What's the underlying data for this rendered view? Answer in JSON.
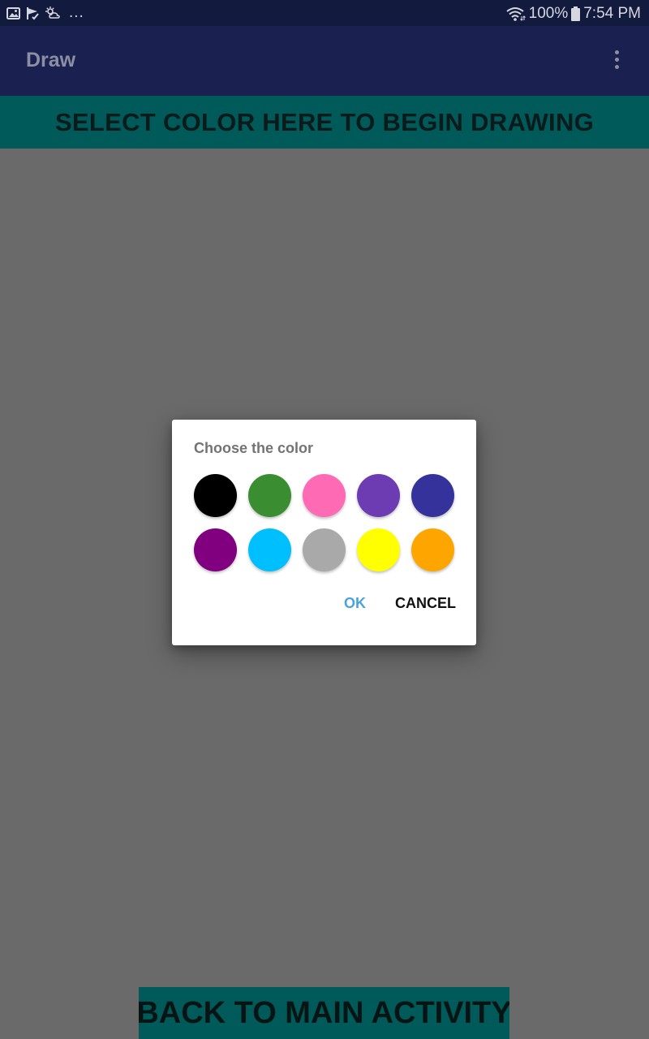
{
  "status_bar": {
    "left_icons": [
      "image-icon",
      "check-flag-icon",
      "weather-icon"
    ],
    "more_indicator": "...",
    "battery_percent": "100%",
    "time": "7:54 PM"
  },
  "app_bar": {
    "title": "Draw"
  },
  "top_button": {
    "label": "SELECT COLOR HERE TO BEGIN DRAWING"
  },
  "dialog": {
    "title": "Choose the color",
    "swatches": [
      {
        "name": "black",
        "color": "#000000"
      },
      {
        "name": "green",
        "color": "#3a8e31"
      },
      {
        "name": "pink",
        "color": "#ff6ab4"
      },
      {
        "name": "purple",
        "color": "#6d3bb2"
      },
      {
        "name": "indigo",
        "color": "#35339b"
      },
      {
        "name": "magenta-purple",
        "color": "#800080"
      },
      {
        "name": "sky-blue",
        "color": "#00bfff"
      },
      {
        "name": "gray",
        "color": "#a9a9a9"
      },
      {
        "name": "yellow",
        "color": "#ffff00"
      },
      {
        "name": "orange",
        "color": "#ffa500"
      }
    ],
    "ok_label": "OK",
    "cancel_label": "CANCEL"
  },
  "bottom_button": {
    "label": "BACK TO MAIN ACTIVITY"
  },
  "colors": {
    "status_bar_bg": "#121a3d",
    "app_bar_bg": "#1a2150",
    "teal_button_bg": "#005a59",
    "scrim_bg": "#6a6a6a",
    "ok_text": "#4aa3df"
  }
}
